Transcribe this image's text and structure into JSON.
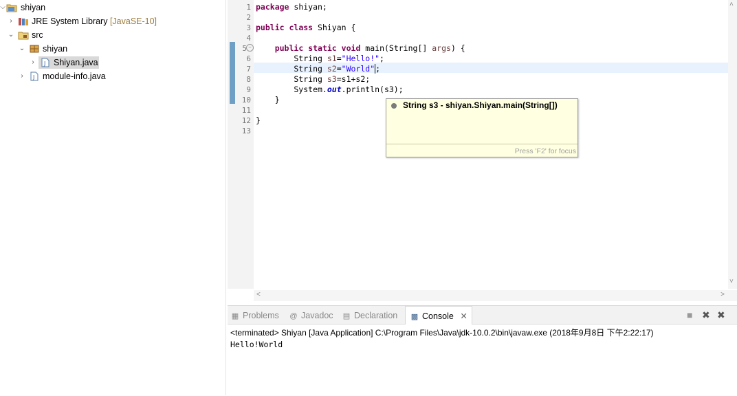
{
  "explorer": {
    "items": [
      {
        "label": "shiyan",
        "decoration": ""
      },
      {
        "label": "JRE System Library",
        "decoration": "[JavaSE-10]"
      },
      {
        "label": "src",
        "decoration": ""
      },
      {
        "label": "shiyan",
        "decoration": ""
      },
      {
        "label": "Shiyan.java",
        "decoration": ""
      },
      {
        "label": "module-info.java",
        "decoration": ""
      }
    ]
  },
  "editor": {
    "line_numbers": [
      "1",
      "2",
      "3",
      "4",
      "5",
      "6",
      "7",
      "8",
      "9",
      "10",
      "11",
      "12",
      "13"
    ],
    "code": {
      "l1_kw": "package",
      "l1_rest": " shiyan;",
      "l3_kw1": "public",
      "l3_kw2": "class",
      "l3_rest": " Shiyan {",
      "l5_indent": "    ",
      "l5_kw1": "public",
      "l5_kw2": "static",
      "l5_kw3": "void",
      "l5_mid": " main(String[] ",
      "l5_arg": "args",
      "l5_end": ") {",
      "l6_a": "        String ",
      "l6_var": "s1",
      "l6_eq": "=",
      "l6_str": "\"Hello!\"",
      "l6_end": ";",
      "l7_a": "        String ",
      "l7_var": "s2",
      "l7_eq": "=",
      "l7_str": "\"World\"",
      "l7_end": ";",
      "l8_a": "        String ",
      "l8_var": "s3",
      "l8_rest": "=s1+s2;",
      "l9_a": "        System.",
      "l9_fld": "out",
      "l9_rest": ".println(s3);",
      "l10": "    }",
      "l12": "}"
    },
    "tooltip": {
      "text": "String s3 - shiyan.Shiyan.main(String[])",
      "hint": "Press 'F2' for focus"
    }
  },
  "views": {
    "tabs": [
      {
        "label": "Problems",
        "icon": "problems-icon"
      },
      {
        "label": "Javadoc",
        "icon": "javadoc-icon"
      },
      {
        "label": "Declaration",
        "icon": "declaration-icon"
      },
      {
        "label": "Console",
        "icon": "console-icon"
      }
    ],
    "console_header": "<terminated> Shiyan [Java Application] C:\\Program Files\\Java\\jdk-10.0.2\\bin\\javaw.exe (2018年9月8日 下午2:22:17)",
    "console_output": "Hello!World"
  }
}
